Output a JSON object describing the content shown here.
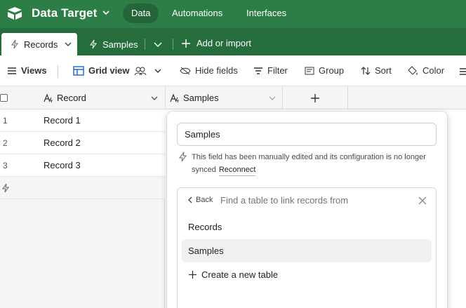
{
  "header": {
    "base_title": "Data Target",
    "nav": [
      {
        "label": "Data"
      },
      {
        "label": "Automations"
      },
      {
        "label": "Interfaces"
      }
    ],
    "colors": {
      "bar": "#2d7d46",
      "tabbar": "#266d3d"
    }
  },
  "tabs": {
    "items": [
      {
        "label": "Records",
        "active": true
      },
      {
        "label": "Samples",
        "active": false
      }
    ],
    "add_import": "Add or import"
  },
  "toolbar": {
    "views": "Views",
    "grid_view": "Grid view",
    "hide_fields": "Hide fields",
    "filter": "Filter",
    "group": "Group",
    "sort": "Sort",
    "color": "Color"
  },
  "grid": {
    "columns": [
      {
        "label": "Record",
        "icon": "formula-icon"
      },
      {
        "label": "Samples",
        "icon": "formula-icon"
      }
    ],
    "rows": [
      {
        "num": "1",
        "record": "Record 1"
      },
      {
        "num": "2",
        "record": "Record 2"
      },
      {
        "num": "3",
        "record": "Record 3"
      }
    ]
  },
  "popup": {
    "field_name_value": "Samples",
    "notice_line1": "This field has been manually edited and its configuration is no longer",
    "notice_line2": "synced",
    "reconnect": "Reconnect",
    "picker": {
      "back": "Back",
      "search_placeholder": "Find a table to link records from",
      "options": [
        {
          "label": "Records",
          "highlighted": false
        },
        {
          "label": "Samples",
          "highlighted": true
        }
      ],
      "create": "Create a new table"
    }
  }
}
